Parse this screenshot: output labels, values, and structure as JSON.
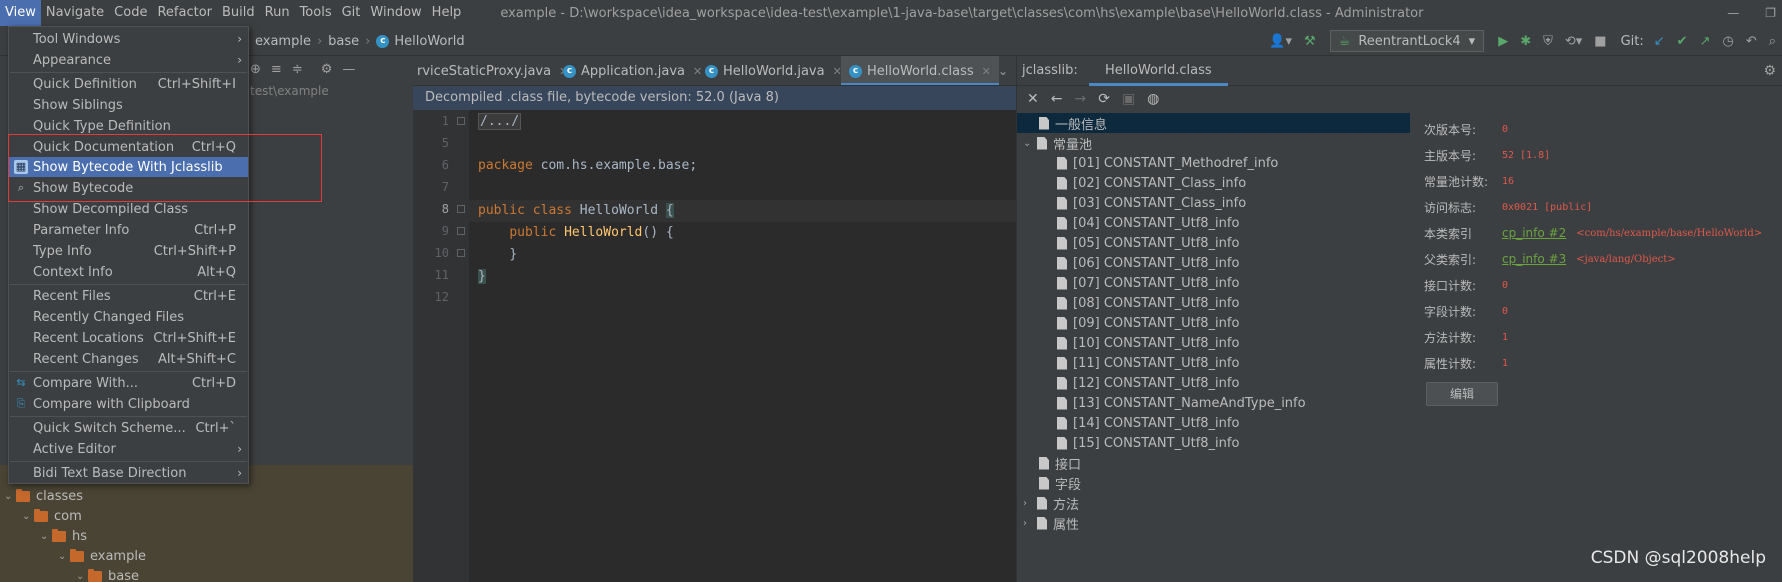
{
  "menubar": {
    "items": [
      "View",
      "Navigate",
      "Code",
      "Refactor",
      "Build",
      "Run",
      "Tools",
      "Git",
      "Window",
      "Help"
    ],
    "title": "example - D:\\workspace\\idea_workspace\\idea-test\\example\\1-java-base\\target\\classes\\com\\hs\\example\\base\\HelloWorld.class - Administrator"
  },
  "breadcrumb": [
    "example",
    "base",
    "HelloWorld"
  ],
  "toolbar": {
    "run_config": "ReentrantLock4",
    "git_label": "Git:"
  },
  "project": {
    "path": "test\\example",
    "tree": [
      "classes",
      "com",
      "hs",
      "example",
      "base"
    ]
  },
  "view_menu": {
    "items": [
      {
        "label": "Tool Windows",
        "shortcut": "",
        "submenu": true
      },
      {
        "label": "Appearance",
        "shortcut": "",
        "submenu": true
      },
      {
        "label": "Quick Definition",
        "shortcut": "Ctrl+Shift+I"
      },
      {
        "label": "Show Siblings",
        "shortcut": ""
      },
      {
        "label": "Quick Type Definition",
        "shortcut": ""
      },
      {
        "label": "Quick Documentation",
        "shortcut": "Ctrl+Q"
      },
      {
        "label": "Show Bytecode With Jclasslib",
        "shortcut": ""
      },
      {
        "label": "Show Bytecode",
        "shortcut": ""
      },
      {
        "label": "Show Decompiled Class",
        "shortcut": ""
      },
      {
        "label": "Parameter Info",
        "shortcut": "Ctrl+P"
      },
      {
        "label": "Type Info",
        "shortcut": "Ctrl+Shift+P"
      },
      {
        "label": "Context Info",
        "shortcut": "Alt+Q"
      },
      {
        "label": "Recent Files",
        "shortcut": "Ctrl+E"
      },
      {
        "label": "Recently Changed Files",
        "shortcut": ""
      },
      {
        "label": "Recent Locations",
        "shortcut": "Ctrl+Shift+E"
      },
      {
        "label": "Recent Changes",
        "shortcut": "Alt+Shift+C"
      },
      {
        "label": "Compare With...",
        "shortcut": "Ctrl+D"
      },
      {
        "label": "Compare with Clipboard",
        "shortcut": ""
      },
      {
        "label": "Quick Switch Scheme...",
        "shortcut": "Ctrl+`"
      },
      {
        "label": "Active Editor",
        "shortcut": "",
        "submenu": true
      },
      {
        "label": "Bidi Text Base Direction",
        "shortcut": "",
        "submenu": true
      }
    ]
  },
  "editor": {
    "tabs": [
      "rviceStaticProxy.java",
      "Application.java",
      "HelloWorld.java",
      "HelloWorld.class"
    ],
    "banner": "Decompiled .class file, bytecode version: 52.0 (Java 8)",
    "line_numbers": [
      "1",
      "5",
      "6",
      "7",
      "8",
      "9",
      "10",
      "11",
      "12"
    ],
    "code": {
      "fold": "/.../",
      "package_kw": "package",
      "package_name": " com.hs.example.base;",
      "public_kw": "public",
      "class_kw": "class",
      "class_name": "HelloWorld",
      "open_brace": "{",
      "ctor_public": "public",
      "ctor_name": "HelloWorld",
      "ctor_rest": "() {",
      "inner_close": "}",
      "outer_close": "}"
    }
  },
  "jclasslib": {
    "label": "jclasslib:",
    "tab": "HelloWorld.class",
    "tree": {
      "general": "一般信息",
      "constant_pool": "常量池",
      "constants": [
        "[01] CONSTANT_Methodref_info",
        "[02] CONSTANT_Class_info",
        "[03] CONSTANT_Class_info",
        "[04] CONSTANT_Utf8_info",
        "[05] CONSTANT_Utf8_info",
        "[06] CONSTANT_Utf8_info",
        "[07] CONSTANT_Utf8_info",
        "[08] CONSTANT_Utf8_info",
        "[09] CONSTANT_Utf8_info",
        "[10] CONSTANT_Utf8_info",
        "[11] CONSTANT_Utf8_info",
        "[12] CONSTANT_Utf8_info",
        "[13] CONSTANT_NameAndType_info",
        "[14] CONSTANT_Utf8_info",
        "[15] CONSTANT_Utf8_info"
      ],
      "interfaces": "接口",
      "fields": "字段",
      "methods": "方法",
      "attributes": "属性"
    },
    "details": {
      "minor_label": "次版本号:",
      "minor_value": "0",
      "major_label": "主版本号:",
      "major_value": "52 [1.8]",
      "cp_count_label": "常量池计数:",
      "cp_count_value": "16",
      "access_label": "访问标志:",
      "access_value": "0x0021 [public]",
      "this_label": "本类索引",
      "this_link": "cp_info #2",
      "this_ref": "<com/hs/example/base/HelloWorld>",
      "super_label": "父类索引:",
      "super_link": "cp_info #3",
      "super_ref": "<java/lang/Object>",
      "iface_label": "接口计数:",
      "iface_value": "0",
      "field_label": "字段计数:",
      "field_value": "0",
      "method_label": "方法计数:",
      "method_value": "1",
      "attr_label": "属性计数:",
      "attr_value": "1",
      "edit_button": "编辑"
    }
  },
  "watermark": "CSDN @sql2008help",
  "colors": {
    "accent": "#4b6eaf",
    "highlight_box": "#e23b3b",
    "keyword": "#cc7832",
    "function": "#ffc66d",
    "value_red": "#e0584a",
    "link_green": "#6ba33f"
  }
}
